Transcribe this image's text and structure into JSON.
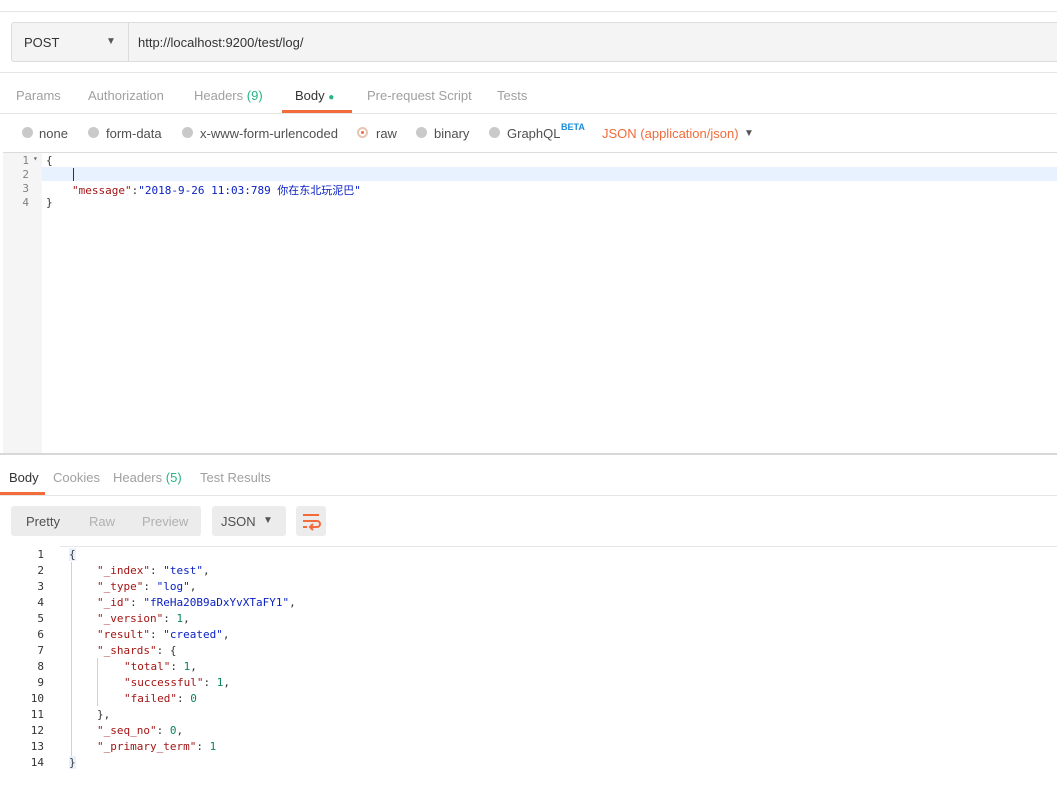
{
  "request": {
    "method": "POST",
    "url": "http://localhost:9200/test/log/"
  },
  "request_tabs": {
    "params": "Params",
    "authorization": "Authorization",
    "headers": "Headers",
    "headers_count": "(9)",
    "body": "Body",
    "prerequest": "Pre-request Script",
    "tests": "Tests"
  },
  "body_types": {
    "none": "none",
    "form_data": "form-data",
    "urlencoded": "x-www-form-urlencoded",
    "raw": "raw",
    "binary": "binary",
    "graphql": "GraphQL",
    "graphql_badge": "BETA",
    "content_type": "JSON (application/json)",
    "selected": "raw"
  },
  "request_body": {
    "line_numbers": [
      "1",
      "2",
      "3",
      "4"
    ],
    "open": "{",
    "key": "\"message\"",
    "colon": ":",
    "value": "\"2018-9-26 11:03:789 你在东北玩泥巴\"",
    "close": "}"
  },
  "response_tabs": {
    "body": "Body",
    "cookies": "Cookies",
    "headers": "Headers",
    "headers_count": "(5)",
    "test_results": "Test Results"
  },
  "response_view": {
    "pretty": "Pretty",
    "raw": "Raw",
    "preview": "Preview",
    "format": "JSON"
  },
  "response_body": {
    "line_numbers": [
      "1",
      "2",
      "3",
      "4",
      "5",
      "6",
      "7",
      "8",
      "9",
      "10",
      "11",
      "12",
      "13",
      "14"
    ],
    "index_key": "\"_index\"",
    "index_val": "\"test\"",
    "type_key": "\"_type\"",
    "type_val": "\"log\"",
    "id_key": "\"_id\"",
    "id_val": "\"fReHa20B9aDxYvXTaFY1\"",
    "version_key": "\"_version\"",
    "version_val": "1",
    "result_key": "\"result\"",
    "result_val": "\"created\"",
    "shards_key": "\"_shards\"",
    "total_key": "\"total\"",
    "total_val": "1",
    "successful_key": "\"successful\"",
    "successful_val": "1",
    "failed_key": "\"failed\"",
    "failed_val": "0",
    "seq_key": "\"_seq_no\"",
    "seq_val": "0",
    "term_key": "\"_primary_term\"",
    "term_val": "1"
  },
  "colors": {
    "accent": "#f26b3a",
    "count_green": "#26b47f",
    "beta_blue": "#1a8cd8"
  }
}
